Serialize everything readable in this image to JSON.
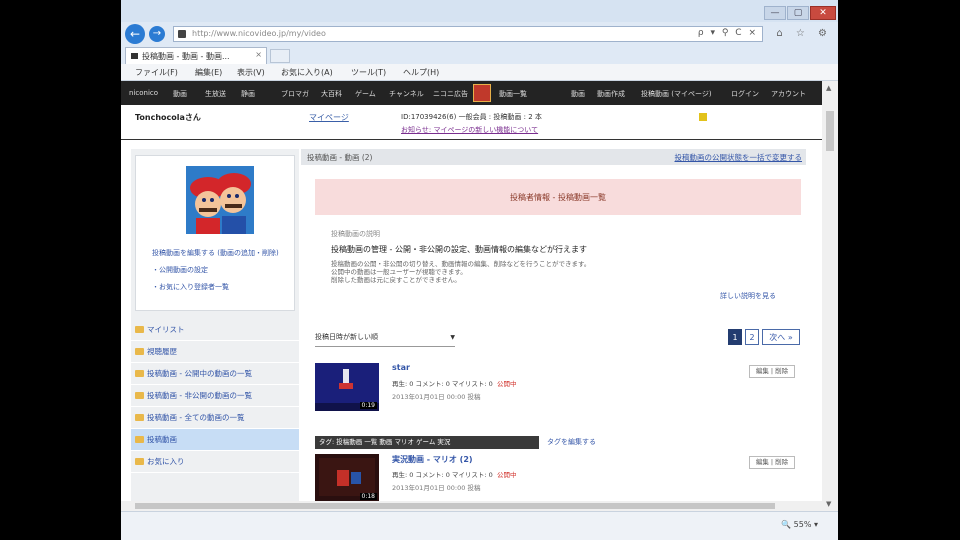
{
  "browser": {
    "address": "http://www.nicovideo.jp/my/video",
    "address_tools": "ρ ▾ ⚲ C ×",
    "right_icons": "⌂ ☆ ⚙",
    "tab_label": "投稿動画 - 動画 - 動画...",
    "tab_close": "×",
    "win_min": "—",
    "win_max": "▢",
    "win_close": "✕",
    "back": "←",
    "forward": "→",
    "menu": [
      "ファイル(F)",
      "編集(E)",
      "表示(V)",
      "お気に入り(A)",
      "ツール(T)",
      "ヘルプ(H)"
    ],
    "zoom": "🔍 55% ▾"
  },
  "site": {
    "nav": [
      "niconico",
      "動画",
      "生放送",
      "静画",
      "ブロマガ",
      "大百科",
      "ゲーム",
      "チャンネル",
      "ニコニ広告",
      "動画一覧"
    ],
    "nav_right": [
      "動画",
      "動画作成",
      "投稿動画 (マイページ)",
      "ログイン",
      "アカウント"
    ],
    "user_name": "Tonchocolaさん",
    "mypage_link": "マイページ",
    "user_stats": "ID:17039426(6) 一般会員 : 投稿動画 : 2 本",
    "user_notice": "お知らせ: マイページの新しい機能について"
  },
  "sidebar": {
    "profile_links": [
      "投稿動画を編集する (動画の追加・削除)",
      "・公開動画の設定",
      "・お気に入り登録者一覧"
    ],
    "folders": [
      "マイリスト",
      "視聴履歴",
      "投稿動画 - 公開中の動画の一覧",
      "投稿動画 - 非公開の動画の一覧",
      "投稿動画 - 全ての動画の一覧",
      "投稿動画",
      "お気に入り"
    ],
    "active_index": 5
  },
  "main": {
    "header_title": "投稿動画 - 動画 (2)",
    "header_right": "投稿動画の公開状態を一括で変更する",
    "alert": "投稿者情報 - 投稿動画一覧",
    "desc_sub": "投稿動画の説明",
    "desc_title": "投稿動画の管理 - 公開・非公開の設定、動画情報の編集などが行えます",
    "desc_lines": [
      "投稿動画の公開・非公開の切り替え、動画情報の編集、削除などを行うことができます。",
      "公開中の動画は一般ユーザーが視聴できます。",
      "削除した動画は元に戻すことができません。"
    ],
    "desc_more": "詳しい説明を見る",
    "sort_label": "投稿日時が新しい順",
    "sort_arrow": "▼",
    "pages": [
      "1",
      "2"
    ],
    "next_label": "次へ »"
  },
  "videos": [
    {
      "title": "star",
      "stats": "再生: 0  コメント: 0  マイリスト: 0",
      "status": "公開中",
      "date": "2013年01月01日 00:00 投稿",
      "duration": "0:19",
      "btn": "編集 | 削除",
      "tag_bar": "タグ: 投稿動画 一覧 動画 マリオ ゲーム 実況",
      "tag_link": "タグを編集する"
    },
    {
      "title": "実況動画 - マリオ (2)",
      "stats": "再生: 0  コメント: 0  マイリスト: 0",
      "status": "公開中",
      "date": "2013年01月01日 00:00 投稿",
      "duration": "0:18",
      "btn": "編集 | 削除"
    }
  ]
}
